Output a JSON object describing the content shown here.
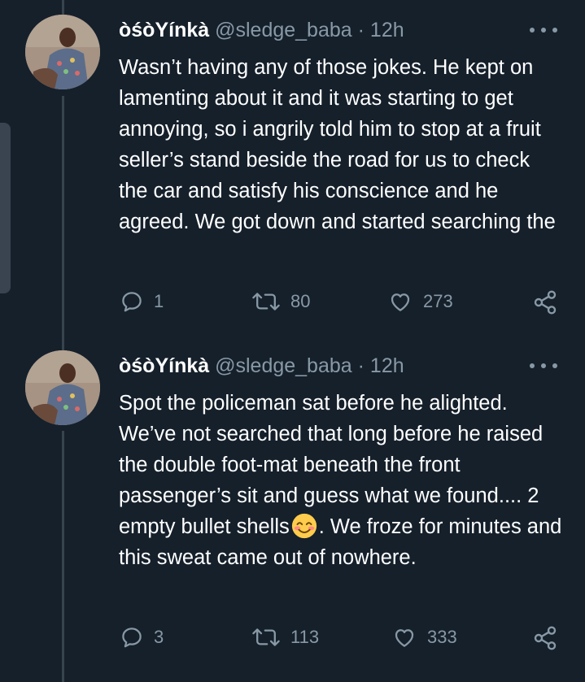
{
  "colors": {
    "background": "#15202b",
    "secondary_text": "#8899a6",
    "thread_line": "#38444d"
  },
  "tweets": [
    {
      "display_name": "òśòYínkà",
      "handle": "@sledge_baba",
      "separator": "·",
      "time": "12h",
      "text": "Wasn’t having any of those jokes. He kept on lamenting about it and it was starting to get annoying, so i angrily told him to stop at a fruit seller’s stand beside the road for us to check the car and satisfy his conscience and he agreed. We got down and started searching the",
      "replies": "1",
      "retweets": "80",
      "likes": "273",
      "icons": [
        "reply-icon",
        "retweet-icon",
        "like-icon",
        "share-icon",
        "more-icon"
      ]
    },
    {
      "display_name": "òśòYínkà",
      "handle": "@sledge_baba",
      "separator": "·",
      "time": "12h",
      "text_before_emoji": "Spot the policeman sat before he alighted. We’ve not searched that long before he raised the double foot-mat beneath the front passenger’s sit and guess what we found.... 2 empty bullet shells",
      "emoji": "smiling-face-with-smiling-eyes",
      "text_after_emoji": ". We froze for minutes and this sweat came out of nowhere.",
      "replies": "3",
      "retweets": "113",
      "likes": "333",
      "icons": [
        "reply-icon",
        "retweet-icon",
        "like-icon",
        "share-icon",
        "more-icon"
      ]
    }
  ]
}
